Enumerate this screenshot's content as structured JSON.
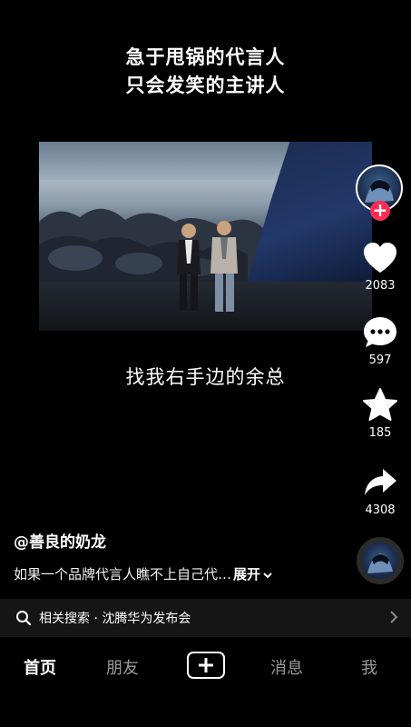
{
  "video": {
    "caption_top_line1": "急于甩锅的代言人",
    "caption_top_line2": "只会发笑的主讲人",
    "subtitle": "找我右手边的余总"
  },
  "actions": {
    "like_count": "2083",
    "comment_count": "597",
    "favorite_count": "185",
    "share_count": "4308",
    "follow_symbol": "+"
  },
  "post": {
    "author": "@善良的奶龙",
    "description": "如果一个品牌代言人瞧不上自己代…",
    "expand_label": "展开"
  },
  "related_search": {
    "label": "相关搜索 · 沈腾华为发布会"
  },
  "tabbar": {
    "home": "首页",
    "friends": "朋友",
    "messages": "消息",
    "me": "我"
  },
  "colors": {
    "background": "#000000",
    "follow_red": "#fe2c55",
    "related_bar": "#151515"
  },
  "icons": [
    "heart-icon",
    "comment-icon",
    "star-icon",
    "share-icon",
    "search-icon",
    "chevron-right-icon",
    "chevron-down-icon",
    "plus-icon"
  ]
}
